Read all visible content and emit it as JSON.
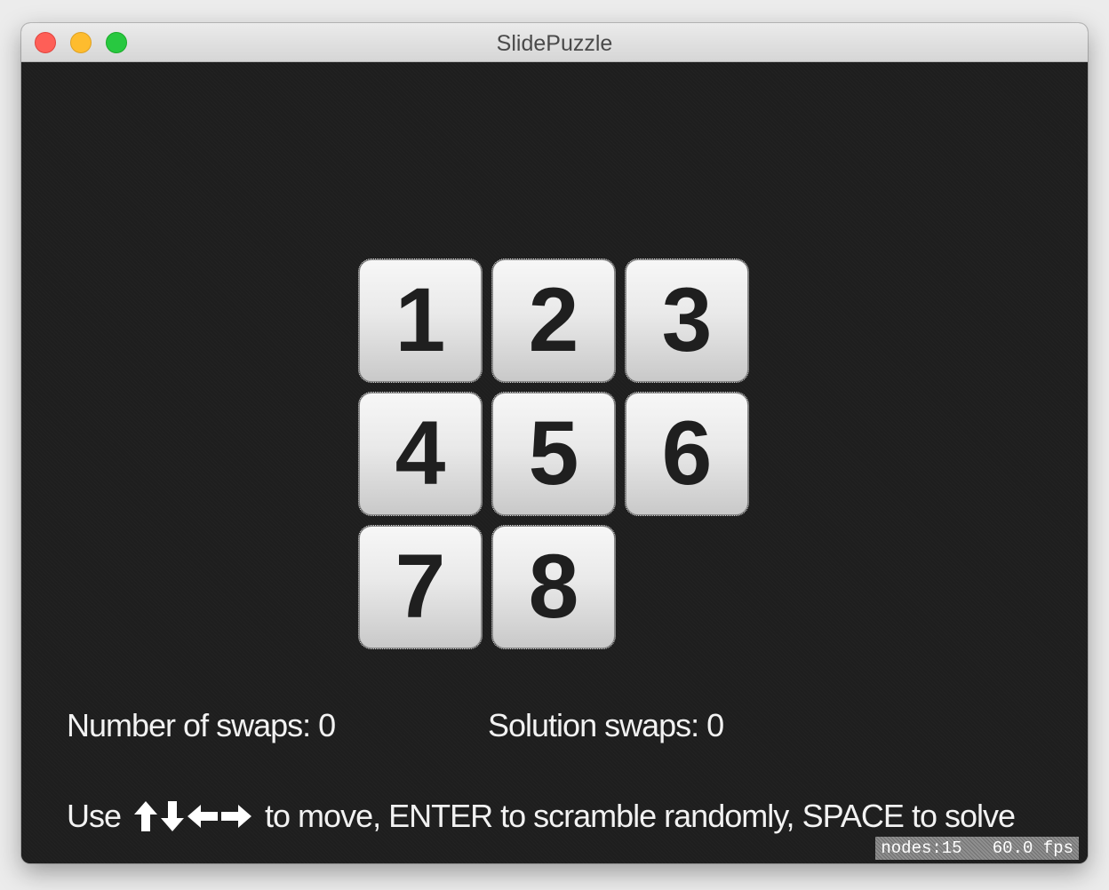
{
  "window": {
    "title": "SlidePuzzle"
  },
  "puzzle": {
    "tiles": [
      "1",
      "2",
      "3",
      "4",
      "5",
      "6",
      "7",
      "8"
    ],
    "empty_slot": 9
  },
  "stats": {
    "swaps_label": "Number of swaps: 0",
    "solution_label": "Solution swaps: 0"
  },
  "instructions": {
    "prefix": "Use",
    "arrow_icons": [
      "arrow-up-icon",
      "arrow-down-icon",
      "arrow-left-icon",
      "arrow-right-icon"
    ],
    "suffix": "to move, ENTER to scramble randomly, SPACE to solve"
  },
  "debug": {
    "text": "nodes:15   60.0 fps"
  },
  "colors": {
    "background": "#1e1e1e",
    "text": "#f2f2f2",
    "tile_text": "#1f1f1f",
    "close": "#fe5f57",
    "minimize": "#febc2e",
    "zoom": "#28c840"
  }
}
